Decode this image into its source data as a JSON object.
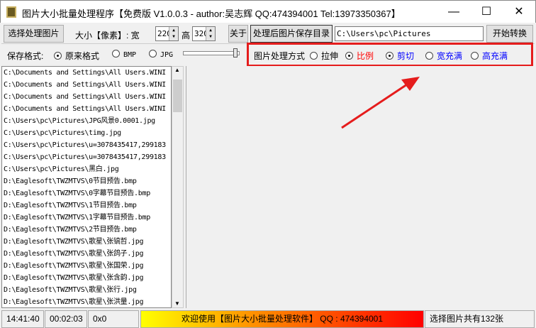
{
  "window": {
    "title": "图片大小批量处理程序【免费版 V1.0.0.3 - author:吴志辉  QQ:474394001 Tel:13973350367】",
    "minimize": "—",
    "maximize": "☐",
    "close": "✕"
  },
  "toolbar": {
    "select_images": "选择处理图片",
    "size_label": "大小【像素】: 宽",
    "width_value": "220",
    "height_label": "高",
    "height_value": "320",
    "about": "关于",
    "output_dir_button": "处理后图片保存目录",
    "output_dir_value": "C:\\Users\\pc\\Pictures",
    "start": "开始转换"
  },
  "options": {
    "save_format_label": "保存格式:",
    "formats": [
      "原来格式",
      "BMP",
      "JPG"
    ],
    "method_label": "图片处理方式",
    "methods": [
      "拉伸",
      "比例",
      "剪切",
      "宽充满",
      "高充满"
    ]
  },
  "colors": {
    "red": "#ff0000",
    "blue": "#0000ff",
    "highlight": "#e51c1c"
  },
  "files": [
    "C:\\Documents and Settings\\All Users.WINI",
    "C:\\Documents and Settings\\All Users.WINI",
    "C:\\Documents and Settings\\All Users.WINI",
    "C:\\Documents and Settings\\All Users.WINI",
    "C:\\Users\\pc\\Pictures\\JPG风景0.0001.jpg",
    "C:\\Users\\pc\\Pictures\\timg.jpg",
    "C:\\Users\\pc\\Pictures\\u=3078435417,299183",
    "C:\\Users\\pc\\Pictures\\u=3078435417,299183",
    "C:\\Users\\pc\\Pictures\\黑白.jpg",
    "D:\\Eaglesoft\\TWZMTVS\\0节目预告.bmp",
    "D:\\Eaglesoft\\TWZMTVS\\0字幕节目预告.bmp",
    "D:\\Eaglesoft\\TWZMTVS\\1节目预告.bmp",
    "D:\\Eaglesoft\\TWZMTVS\\1字幕节目预告.bmp",
    "D:\\Eaglesoft\\TWZMTVS\\2节目预告.bmp",
    "D:\\Eaglesoft\\TWZMTVS\\歌星\\张镐哲.jpg",
    "D:\\Eaglesoft\\TWZMTVS\\歌星\\张鸽子.jpg",
    "D:\\Eaglesoft\\TWZMTVS\\歌星\\张国荣.jpg",
    "D:\\Eaglesoft\\TWZMTVS\\歌星\\张含韵.jpg",
    "D:\\Eaglesoft\\TWZMTVS\\歌星\\张行.jpg",
    "D:\\Eaglesoft\\TWZMTVS\\歌星\\张洪量.jpg"
  ],
  "status": {
    "time": "14:41:40",
    "elapsed": "00:02:03",
    "dims": "0x0",
    "banner": "欢迎使用【图片大小批量处理软件】 QQ : 474394001",
    "count": "选择图片共有132张"
  }
}
